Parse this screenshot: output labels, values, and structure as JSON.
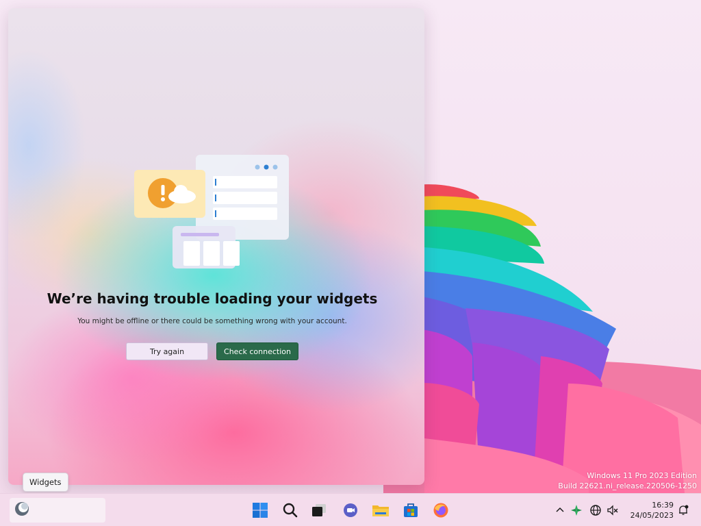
{
  "panel": {
    "title": "We’re having trouble loading your widgets",
    "message": "You might be offline or there could be something wrong with your account.",
    "try_again_label": "Try again",
    "check_connection_label": "Check connection"
  },
  "tooltip": {
    "text": "Widgets"
  },
  "watermark": {
    "line1": "Windows 11 Pro 2023 Edition",
    "line2": "Build 22621.ni_release.220506-1250"
  },
  "taskbar": {
    "pinned": [
      {
        "name": "start-icon"
      },
      {
        "name": "search-icon"
      },
      {
        "name": "task-view-icon"
      },
      {
        "name": "teams-chat-icon"
      },
      {
        "name": "file-explorer-icon"
      },
      {
        "name": "microsoft-store-icon"
      },
      {
        "name": "firefox-icon"
      }
    ],
    "tray": {
      "time": "16:39",
      "date": "24/05/2023"
    }
  },
  "colors": {
    "accent": "#2a6a4a",
    "taskbar": "#f4dcec",
    "warning": "#f0a030"
  }
}
